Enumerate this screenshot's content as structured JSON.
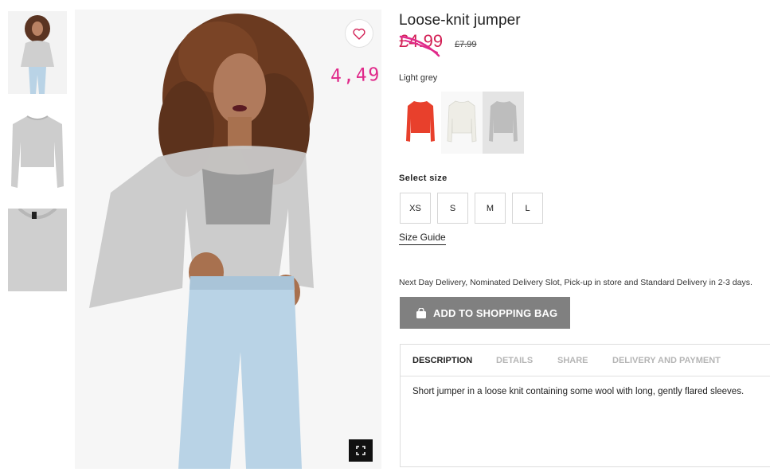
{
  "product": {
    "title": "Loose-knit jumper",
    "price": "£4.99",
    "old_price": "£7.99",
    "annotation": "4,49",
    "color_name": "Light grey"
  },
  "colors": {
    "price_red": "#d21f54",
    "annotation_pink": "#e0298a",
    "button_grey": "#808080",
    "selected_swatch_bg": "#e6e6e6"
  },
  "swatches": [
    {
      "name": "Red",
      "color": "#e8402c",
      "selected": false
    },
    {
      "name": "White",
      "color": "#f3f2ec",
      "selected": false
    },
    {
      "name": "Light grey",
      "color": "#c6c6c6",
      "selected": true
    }
  ],
  "sizes": {
    "label": "Select size",
    "options": [
      "XS",
      "S",
      "M",
      "L"
    ],
    "guide_label": "Size Guide"
  },
  "delivery_text": "Next Day Delivery, Nominated Delivery Slot, Pick-up in store and Standard Delivery in 2-3 days.",
  "add_to_bag_label": "ADD TO SHOPPING BAG",
  "tabs": [
    {
      "label": "DESCRIPTION",
      "active": true
    },
    {
      "label": "DETAILS",
      "active": false
    },
    {
      "label": "SHARE",
      "active": false
    },
    {
      "label": "DELIVERY AND PAYMENT",
      "active": false
    }
  ],
  "description": "Short jumper in a loose knit containing some wool with long, gently flared sleeves.",
  "icons": {
    "favorite": "heart-icon",
    "fullscreen": "expand-icon",
    "bag": "shopping-bag-icon"
  }
}
